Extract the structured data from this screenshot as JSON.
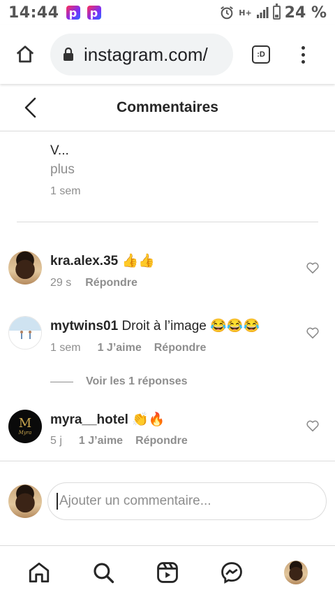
{
  "status_bar": {
    "time": "14:44",
    "app_icons": [
      "p",
      "p"
    ],
    "network": "H+",
    "battery": "24 %"
  },
  "browser": {
    "url": "instagram.com/",
    "tab_label": ":D"
  },
  "header": {
    "title": "Commentaires"
  },
  "previous_comment": {
    "text": "V...",
    "more": "plus",
    "time": "1 sem"
  },
  "comments": [
    {
      "username": "kra.alex.35",
      "text": "👍👍",
      "time": "29 s",
      "likes": "",
      "reply": "Répondre"
    },
    {
      "username": "mytwins01",
      "text": "Droit à l’image 😂😂😂",
      "time": "1 sem",
      "likes": "1 J’aime",
      "reply": "Répondre"
    },
    {
      "username": "myra__hotel",
      "text": "👏🔥",
      "time": "5 j",
      "likes": "1 J’aime",
      "reply": "Répondre"
    }
  ],
  "view_replies": "Voir les 1 réponses",
  "avatars": {
    "myra_letter": "M",
    "myra_script": "Myra"
  },
  "composer": {
    "placeholder": "Ajouter un commentaire..."
  },
  "colors": {
    "text": "#262626",
    "secondary": "#8e8e8e",
    "divider": "#dbdbdb"
  },
  "nav_icons": [
    "home-icon",
    "search-icon",
    "reels-icon",
    "messenger-icon",
    "profile-avatar"
  ]
}
